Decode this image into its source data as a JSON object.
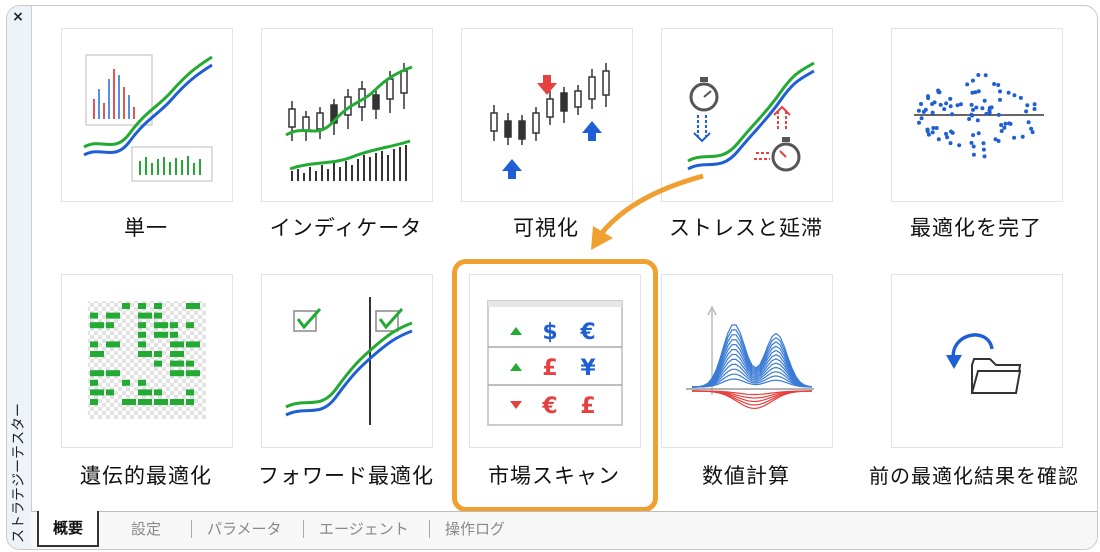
{
  "panel": {
    "title": "ストラテジーテスター",
    "close_label": "×"
  },
  "modes": [
    {
      "label": "単一"
    },
    {
      "label": "インディケータ"
    },
    {
      "label": "可視化"
    },
    {
      "label": "ストレスと延滞"
    },
    {
      "label": "最適化を完了"
    },
    {
      "label": "遺伝的最適化"
    },
    {
      "label": "フォワード最適化"
    },
    {
      "label": "市場スキャン"
    },
    {
      "label": "数値計算"
    },
    {
      "label": "前の最適化結果を確認"
    }
  ],
  "market_scan_symbols": [
    "$",
    "€",
    "£",
    "¥",
    "€",
    "£"
  ],
  "highlighted_mode": "市場スキャン",
  "tabs": [
    {
      "label": "概要",
      "active": true
    },
    {
      "label": "設定"
    },
    {
      "label": "パラメータ"
    },
    {
      "label": "エージェント"
    },
    {
      "label": "操作ログ"
    }
  ],
  "colors": {
    "accent_orange": "#f0a030",
    "green": "#22aa33",
    "blue": "#1f5fd6",
    "red": "#e64040"
  }
}
